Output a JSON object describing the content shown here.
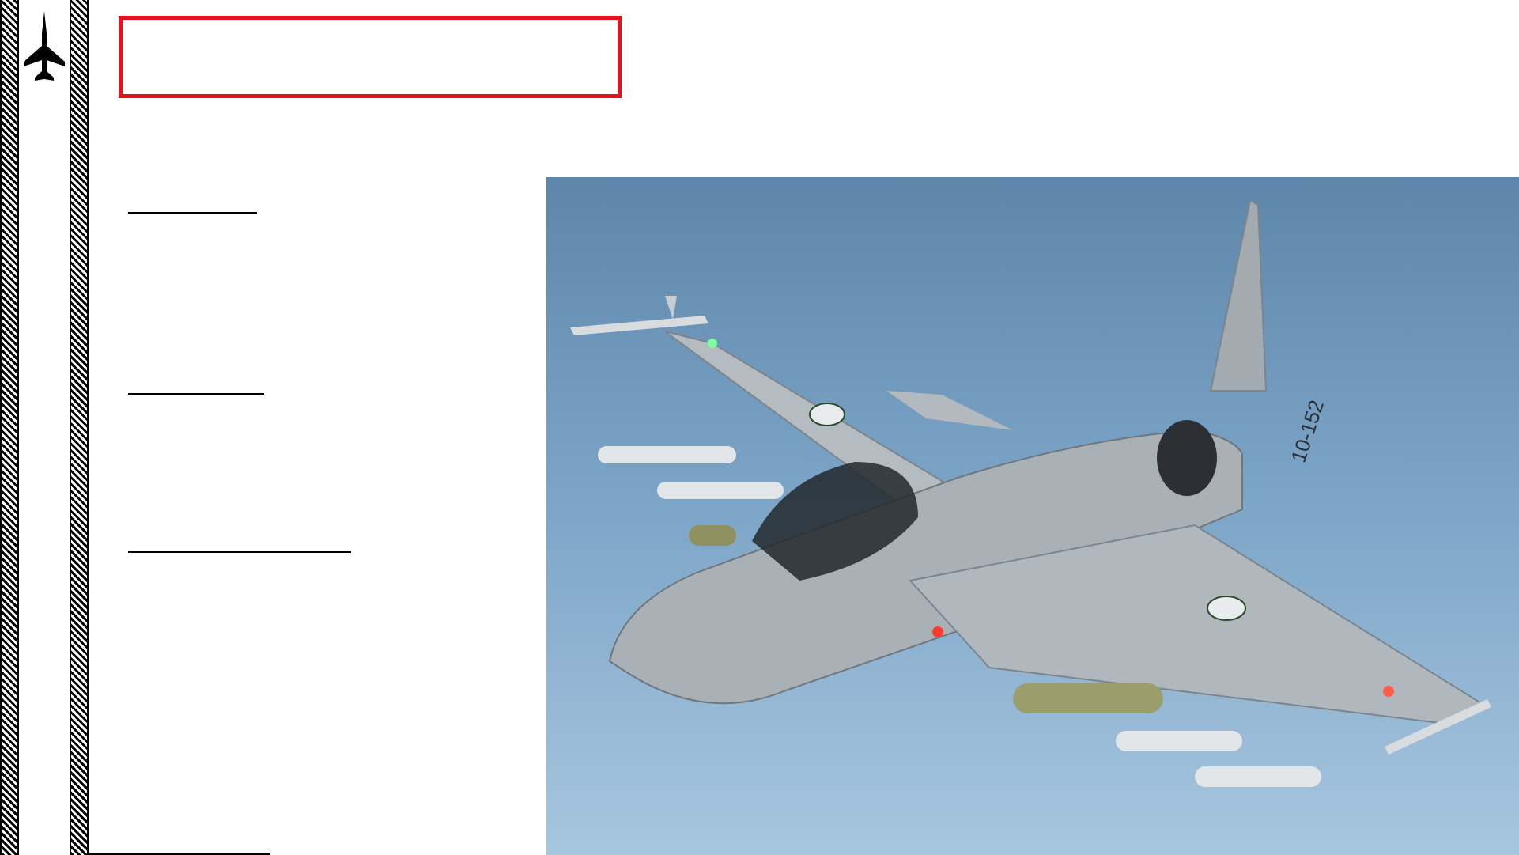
{
  "page": {
    "title": "",
    "sections": [
      {
        "heading": ""
      },
      {
        "heading": ""
      },
      {
        "heading": ""
      }
    ]
  },
  "colors": {
    "title_box_border": "#e8101a",
    "sky_top": "#5e86ab",
    "sky_bottom": "#a7c6df",
    "aircraft_body": "#a9b1b7"
  },
  "icons": {
    "logo": "fighter-jet-silhouette-icon"
  },
  "photo": {
    "aircraft_tail_code": "10-152"
  }
}
